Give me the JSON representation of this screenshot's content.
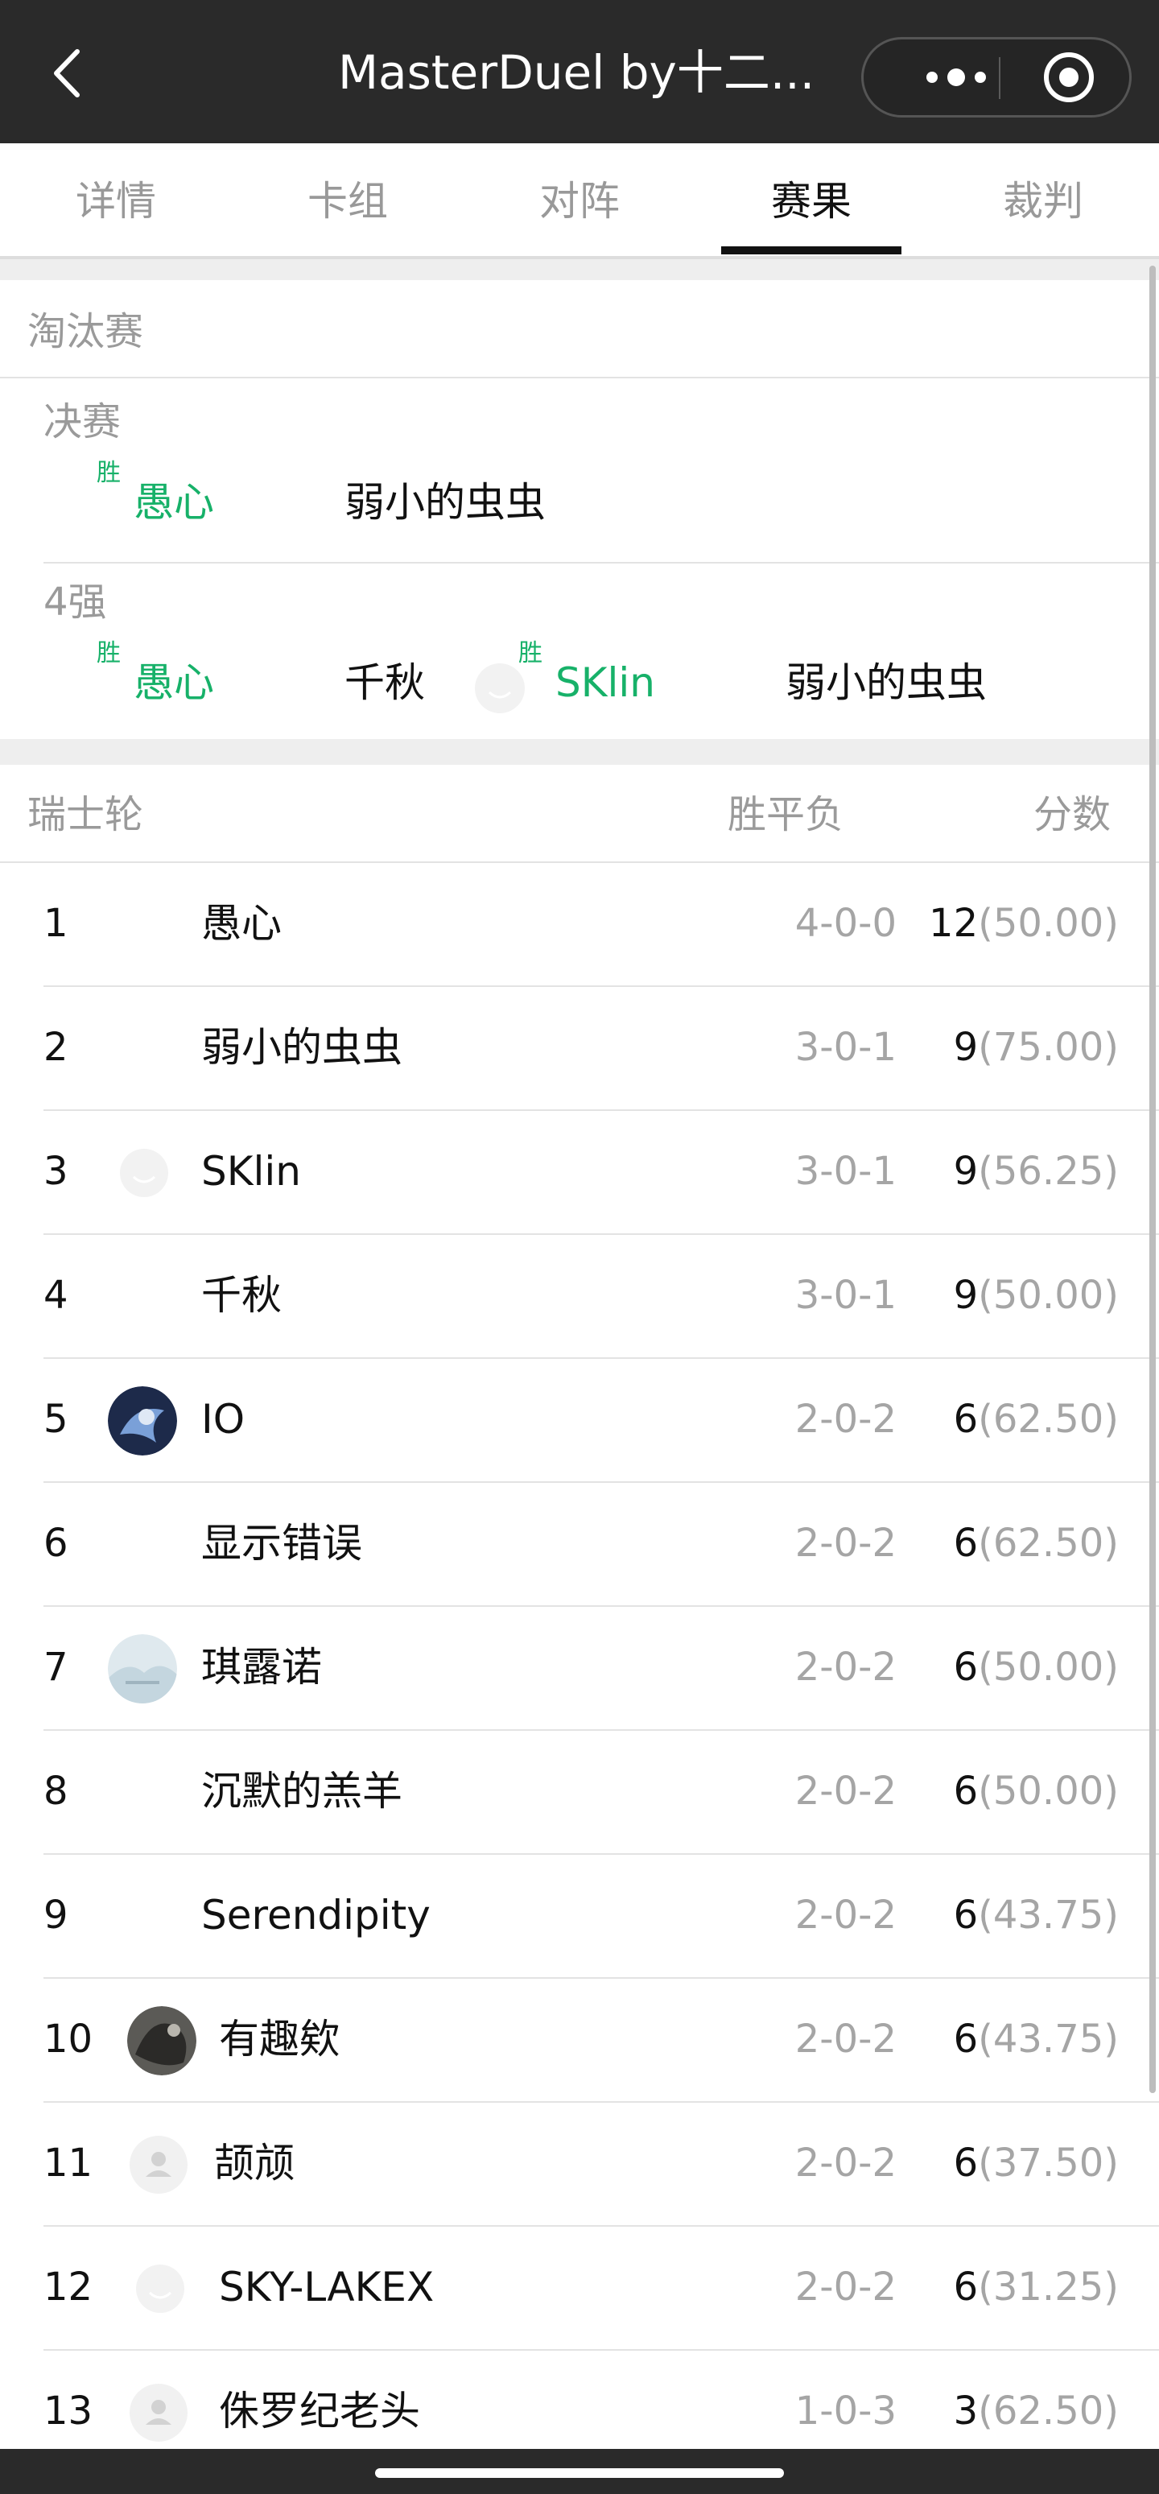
{
  "topbar": {
    "title": "MasterDuel by十二...",
    "icons": {
      "back": "chevron-left-icon",
      "more": "more-dots-icon",
      "record": "record-circle-icon"
    }
  },
  "tabs": [
    {
      "label": "详情",
      "active": false
    },
    {
      "label": "卡组",
      "active": false
    },
    {
      "label": "对阵",
      "active": false
    },
    {
      "label": "赛果",
      "active": true
    },
    {
      "label": "裁判",
      "active": false
    }
  ],
  "knockout": {
    "title": "淘汰赛",
    "win_tag": "胜",
    "rounds": [
      {
        "label": "决赛",
        "matches": [
          {
            "p1": "愚心",
            "p1_win": true,
            "p2": "弱小的虫虫",
            "p2_win": false
          }
        ]
      },
      {
        "label": "4强",
        "matches": [
          {
            "p1": "愚心",
            "p1_win": true,
            "p2": "千秋",
            "p2_win": false
          },
          {
            "p1": "SKlin",
            "p1_win": true,
            "p2": "弱小的虫虫",
            "p2_win": false
          }
        ]
      }
    ]
  },
  "swiss": {
    "title": "瑞士轮",
    "col_wdl": "胜平负",
    "col_score": "分数",
    "rows": [
      {
        "rank": "1",
        "name": "愚心",
        "wdl": "4-0-0",
        "points": "12",
        "tiebreak": "(50.00)",
        "avatar": "none"
      },
      {
        "rank": "2",
        "name": "弱小的虫虫",
        "wdl": "3-0-1",
        "points": "9",
        "tiebreak": "(75.00)",
        "avatar": "none"
      },
      {
        "rank": "3",
        "name": "SKlin",
        "wdl": "3-0-1",
        "points": "9",
        "tiebreak": "(56.25)",
        "avatar": "ghost"
      },
      {
        "rank": "4",
        "name": "千秋",
        "wdl": "3-0-1",
        "points": "9",
        "tiebreak": "(50.00)",
        "avatar": "none"
      },
      {
        "rank": "5",
        "name": "IO",
        "wdl": "2-0-2",
        "points": "6",
        "tiebreak": "(62.50)",
        "avatar": "dark-blue"
      },
      {
        "rank": "6",
        "name": "显示错误",
        "wdl": "2-0-2",
        "points": "6",
        "tiebreak": "(62.50)",
        "avatar": "none"
      },
      {
        "rank": "7",
        "name": "琪露诺",
        "wdl": "2-0-2",
        "points": "6",
        "tiebreak": "(50.00)",
        "avatar": "light-blue"
      },
      {
        "rank": "8",
        "name": "沉默的羔羊",
        "wdl": "2-0-2",
        "points": "6",
        "tiebreak": "(50.00)",
        "avatar": "none"
      },
      {
        "rank": "9",
        "name": "Serendipity",
        "wdl": "2-0-2",
        "points": "6",
        "tiebreak": "(43.75)",
        "avatar": "none"
      },
      {
        "rank": "10",
        "name": "有趣欸",
        "wdl": "2-0-2",
        "points": "6",
        "tiebreak": "(43.75)",
        "avatar": "dark-photo"
      },
      {
        "rank": "11",
        "name": "颉颃",
        "wdl": "2-0-2",
        "points": "6",
        "tiebreak": "(37.50)",
        "avatar": "default-person"
      },
      {
        "rank": "12",
        "name": "SKY-LAKEX",
        "wdl": "2-0-2",
        "points": "6",
        "tiebreak": "(31.25)",
        "avatar": "ghost"
      },
      {
        "rank": "13",
        "name": "侏罗纪老头",
        "wdl": "1-0-3",
        "points": "3",
        "tiebreak": "(62.50)",
        "avatar": "default-person"
      }
    ]
  },
  "colors": {
    "win_green": "#17b169",
    "topbar_bg": "#2a2a2a",
    "muted_text": "#9a9a9a"
  }
}
